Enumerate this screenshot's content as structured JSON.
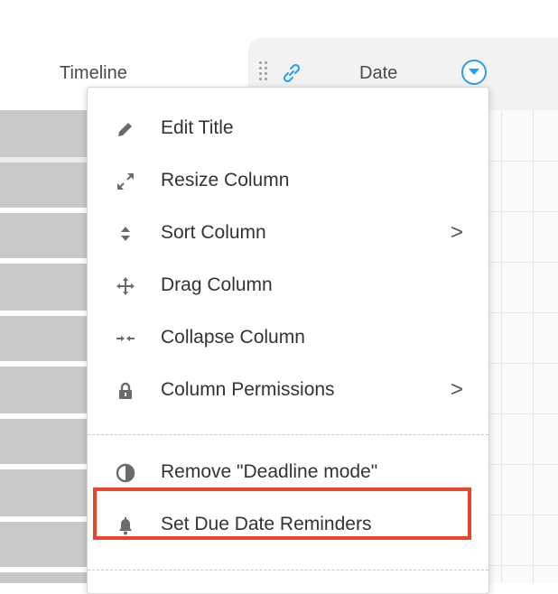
{
  "header": {
    "timeline_label": "Timeline",
    "date_label": "Date"
  },
  "menu": {
    "items": [
      {
        "label": "Edit Title",
        "icon": "pencil-icon",
        "submenu": false
      },
      {
        "label": "Resize Column",
        "icon": "resize-icon",
        "submenu": false
      },
      {
        "label": "Sort Column",
        "icon": "sort-icon",
        "submenu": true
      },
      {
        "label": "Drag Column",
        "icon": "move-icon",
        "submenu": false
      },
      {
        "label": "Collapse Column",
        "icon": "collapse-icon",
        "submenu": false
      },
      {
        "label": "Column Permissions",
        "icon": "lock-icon",
        "submenu": true
      },
      {
        "label": "Remove \"Deadline mode\"",
        "icon": "half-circle-icon",
        "submenu": false
      },
      {
        "label": "Set Due Date Reminders",
        "icon": "bell-icon",
        "submenu": false
      }
    ],
    "chevron": ">"
  },
  "colors": {
    "accent": "#2d9bf0",
    "highlight": "#e8452c",
    "icon": "#6b6b6b"
  }
}
